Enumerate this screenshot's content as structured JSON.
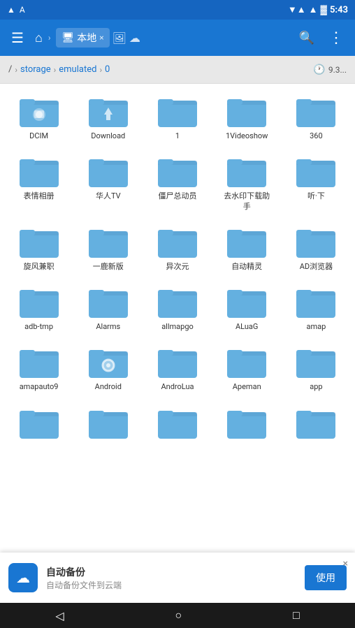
{
  "statusBar": {
    "leftIcons": [
      "A",
      "▲"
    ],
    "time": "5:43",
    "rightIcons": [
      "▼",
      "▲",
      "4",
      ""
    ]
  },
  "topBar": {
    "menuIcon": "☰",
    "homeIcon": "⌂",
    "tabLabel": "本地",
    "tabCloseIcon": "×",
    "extraIcons": [
      "🖼",
      "☁"
    ],
    "searchIcon": "🔍",
    "moreIcon": "⋮"
  },
  "breadcrumb": {
    "rootIcon": "/",
    "path": [
      "storage",
      "emulated",
      "0"
    ],
    "storageInfo": "9.3..."
  },
  "files": [
    {
      "name": "DCIM",
      "hasPhoto": true
    },
    {
      "name": "Download",
      "hasArrow": true
    },
    {
      "name": "1",
      "plain": true
    },
    {
      "name": "1Videoshow",
      "plain": true
    },
    {
      "name": "360",
      "plain": true
    },
    {
      "name": "表情相册",
      "plain": true
    },
    {
      "name": "华人TV",
      "plain": true
    },
    {
      "name": "僵尸总动员",
      "plain": true
    },
    {
      "name": "去水印下载助手",
      "plain": true
    },
    {
      "name": "听·下",
      "plain": true
    },
    {
      "name": "旋风兼职",
      "plain": true
    },
    {
      "name": "一鹿新版",
      "plain": true
    },
    {
      "name": "异次元",
      "plain": true
    },
    {
      "name": "自动精灵",
      "plain": true
    },
    {
      "name": "AD浏览器",
      "plain": true
    },
    {
      "name": "adb-tmp",
      "plain": true
    },
    {
      "name": "Alarms",
      "plain": true
    },
    {
      "name": "allmapgo",
      "plain": true
    },
    {
      "name": "ALuaG",
      "plain": true
    },
    {
      "name": "amap",
      "plain": true
    },
    {
      "name": "amapauto9",
      "plain": true
    },
    {
      "name": "Android",
      "hasGear": true
    },
    {
      "name": "AndroLua",
      "plain": true
    },
    {
      "name": "Apeman",
      "plain": true
    },
    {
      "name": "app",
      "plain": true
    },
    {
      "name": "...",
      "plain": true
    },
    {
      "name": "...",
      "plain": true
    },
    {
      "name": "...",
      "plain": true
    },
    {
      "name": "...",
      "plain": true
    },
    {
      "name": "...",
      "plain": true
    }
  ],
  "banner": {
    "icon": "☁",
    "title": "自动备份",
    "subtitle": "自动备份文件到云端",
    "buttonLabel": "使用",
    "closeIcon": "×"
  },
  "navBar": {
    "backIcon": "◁",
    "homeIcon": "○",
    "recentIcon": "□"
  }
}
